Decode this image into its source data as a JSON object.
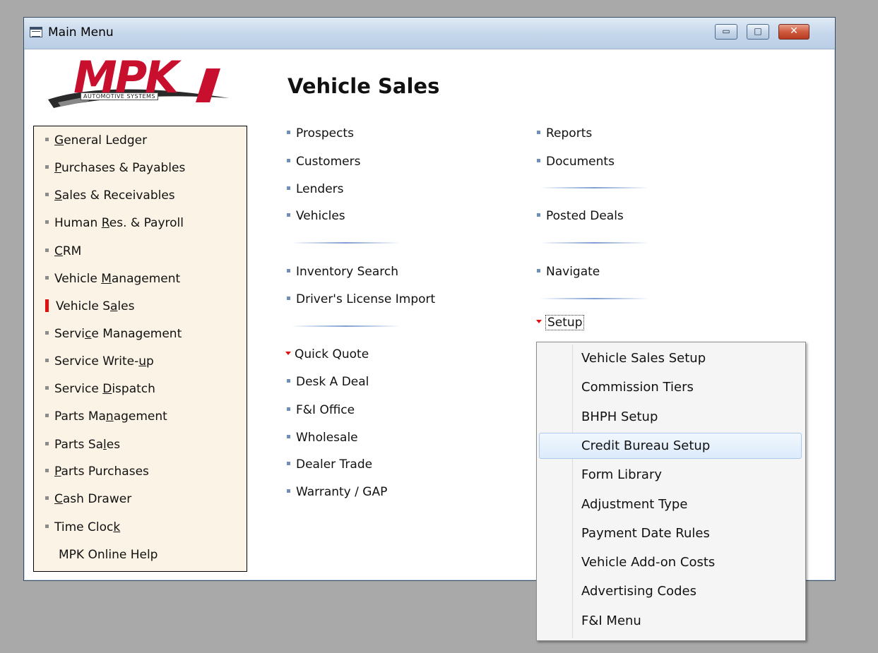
{
  "window": {
    "title": "Main Menu",
    "controls": {
      "minimize": "▭",
      "maximize": "□",
      "close": "✕"
    }
  },
  "logo": {
    "brand": "MPK",
    "subtitle": "AUTOMOTIVE SYSTEMS"
  },
  "sidebar": {
    "items": [
      {
        "pre": "",
        "u": "G",
        "post": "eneral Ledger",
        "active": false
      },
      {
        "pre": "",
        "u": "P",
        "post": "urchases & Payables",
        "active": false
      },
      {
        "pre": "",
        "u": "S",
        "post": "ales & Receivables",
        "active": false
      },
      {
        "pre": "Human ",
        "u": "R",
        "post": "es. & Payroll",
        "active": false
      },
      {
        "pre": "",
        "u": "C",
        "post": "RM",
        "active": false
      },
      {
        "pre": "Vehicle ",
        "u": "M",
        "post": "anagement",
        "active": false
      },
      {
        "pre": "Vehicle S",
        "u": "a",
        "post": "les",
        "active": true
      },
      {
        "pre": "Servi",
        "u": "c",
        "post": "e Management",
        "active": false
      },
      {
        "pre": "Service Write-",
        "u": "u",
        "post": "p",
        "active": false
      },
      {
        "pre": "Service ",
        "u": "D",
        "post": "ispatch",
        "active": false
      },
      {
        "pre": "Parts Ma",
        "u": "n",
        "post": "agement",
        "active": false
      },
      {
        "pre": "Parts Sa",
        "u": "l",
        "post": "es",
        "active": false
      },
      {
        "pre": "",
        "u": "P",
        "post": "arts Purchases",
        "active": false
      },
      {
        "pre": "",
        "u": "C",
        "post": "ash Drawer",
        "active": false
      },
      {
        "pre": "Time Cloc",
        "u": "k",
        "post": "",
        "active": false
      }
    ],
    "help": "MPK Online Help"
  },
  "main": {
    "title": "Vehicle Sales",
    "col1": {
      "group1": [
        "Prospects",
        "Customers",
        "Lenders",
        "Vehicles"
      ],
      "group2": [
        "Inventory Search",
        "Driver's License Import"
      ],
      "quick_quote": "Quick Quote",
      "group3": [
        "Desk A Deal",
        "F&I Office",
        "Wholesale",
        "Dealer Trade",
        "Warranty / GAP"
      ]
    },
    "col2": {
      "group1": [
        "Reports",
        "Documents"
      ],
      "posted_deals": "Posted Deals",
      "navigate": "Navigate",
      "setup": "Setup"
    }
  },
  "setup_menu": {
    "items": [
      "Vehicle Sales Setup",
      "Commission Tiers",
      "BHPH Setup",
      "Credit Bureau Setup",
      "Form Library",
      "Adjustment Type",
      "Payment Date Rules",
      "Vehicle Add-on Costs",
      "Advertising Codes",
      "F&I Menu"
    ],
    "highlighted": "Credit Bureau Setup"
  },
  "colors": {
    "accent_red": "#e01010",
    "panel_bg": "#fbf3e6",
    "highlight": "#dcebfb"
  }
}
